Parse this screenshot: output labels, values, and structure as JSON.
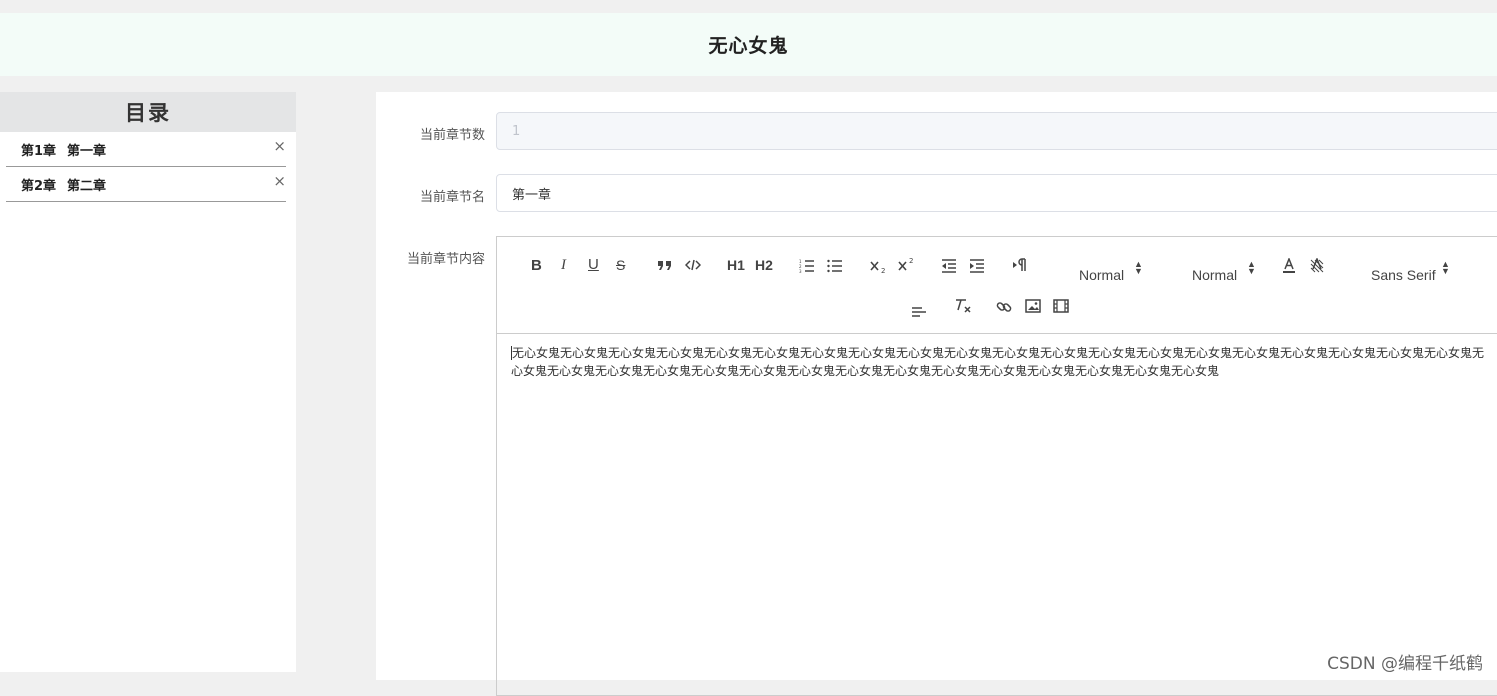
{
  "header": {
    "title": "无心女鬼"
  },
  "sidebar": {
    "heading": "目录",
    "items": [
      {
        "num": "第1章",
        "name": "第一章",
        "close": "×"
      },
      {
        "num": "第2章",
        "name": "第二章",
        "close": "×"
      }
    ]
  },
  "form": {
    "chapter_number_label": "当前章节数",
    "chapter_number_value": "1",
    "chapter_name_label": "当前章节名",
    "chapter_name_value": "第一章",
    "chapter_content_label": "当前章节内容"
  },
  "toolbar": {
    "bold": "B",
    "italic": "I",
    "underline": "U",
    "strike": "S",
    "h1": "H1",
    "h2": "H2",
    "header_select": "Normal",
    "size_select": "Normal",
    "font_select": "Sans Serif"
  },
  "editor": {
    "content": "无心女鬼无心女鬼无心女鬼无心女鬼无心女鬼无心女鬼无心女鬼无心女鬼无心女鬼无心女鬼无心女鬼无心女鬼无心女鬼无心女鬼无心女鬼无心女鬼无心女鬼无心女鬼无心女鬼无心女鬼无心女鬼无心女鬼无心女鬼无心女鬼无心女鬼无心女鬼无心女鬼无心女鬼无心女鬼无心女鬼无心女鬼无心女鬼无心女鬼无心女鬼无心女鬼"
  },
  "watermark": "CSDN @编程千纸鹤"
}
